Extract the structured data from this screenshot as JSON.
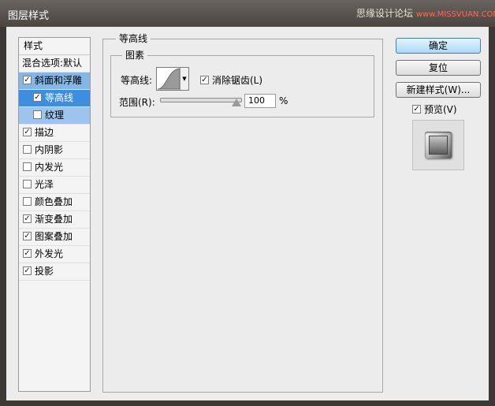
{
  "window": {
    "title": "图层样式",
    "watermark": "思缘设计论坛",
    "watermark_url": "www.MISSVUAN.COM"
  },
  "styles_list": {
    "header": "样式",
    "blend_options": "混合选项:默认",
    "items": [
      {
        "label": "斜面和浮雕",
        "checked": "✓"
      },
      {
        "label": "等高线",
        "checked": "✓"
      },
      {
        "label": "纹理",
        "checked": ""
      },
      {
        "label": "描边",
        "checked": "✓"
      },
      {
        "label": "内阴影",
        "checked": ""
      },
      {
        "label": "内发光",
        "checked": ""
      },
      {
        "label": "光泽",
        "checked": ""
      },
      {
        "label": "颜色叠加",
        "checked": ""
      },
      {
        "label": "渐变叠加",
        "checked": "✓"
      },
      {
        "label": "图案叠加",
        "checked": "✓"
      },
      {
        "label": "外发光",
        "checked": "✓"
      },
      {
        "label": "投影",
        "checked": "✓"
      }
    ]
  },
  "panel": {
    "section_title": "等高线",
    "subgroup_title": "图素",
    "contour_label": "等高线:",
    "antialias_label": "消除锯齿(L)",
    "antialias_checked": "✓",
    "range_label": "范围(R):",
    "range_value": "100",
    "range_unit": "%",
    "range_level": 1.0
  },
  "buttons": {
    "ok": "确定",
    "reset": "复位",
    "new_style": "新建样式(W)...",
    "preview_label": "预览(V)",
    "preview_checked": "✓"
  }
}
